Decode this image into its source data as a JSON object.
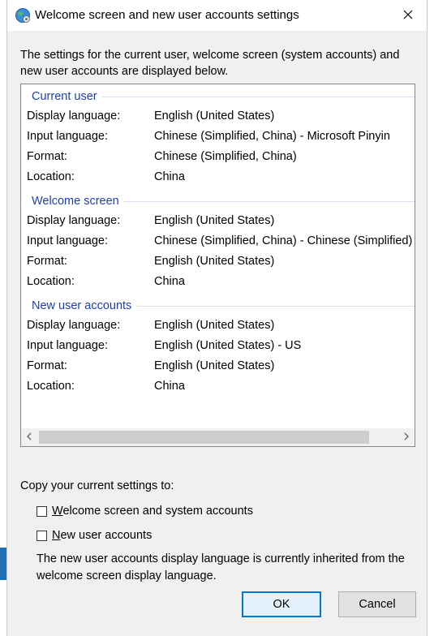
{
  "window": {
    "title": "Welcome screen and new user accounts settings"
  },
  "intro": "The settings for the current user, welcome screen (system accounts) and new user accounts are displayed below.",
  "groups": [
    {
      "header": "Current user",
      "rows": [
        {
          "key": "Display language:",
          "value": "English (United States)"
        },
        {
          "key": "Input language:",
          "value": "Chinese (Simplified, China) - Microsoft Pinyin"
        },
        {
          "key": "Format:",
          "value": "Chinese (Simplified, China)"
        },
        {
          "key": "Location:",
          "value": "China"
        }
      ]
    },
    {
      "header": "Welcome screen",
      "rows": [
        {
          "key": "Display language:",
          "value": "English (United States)"
        },
        {
          "key": "Input language:",
          "value": "Chinese (Simplified, China) - Chinese (Simplified)"
        },
        {
          "key": "Format:",
          "value": "English (United States)"
        },
        {
          "key": "Location:",
          "value": "China"
        }
      ]
    },
    {
      "header": "New user accounts",
      "rows": [
        {
          "key": "Display language:",
          "value": "English (United States)"
        },
        {
          "key": "Input language:",
          "value": "English (United States) - US"
        },
        {
          "key": "Format:",
          "value": "English (United States)"
        },
        {
          "key": "Location:",
          "value": "China"
        }
      ]
    }
  ],
  "copy_section": {
    "label": "Copy your current settings to:",
    "checkboxes": [
      {
        "first_letter": "W",
        "rest": "elcome screen and system accounts",
        "checked": false
      },
      {
        "first_letter": "N",
        "rest": "ew user accounts",
        "checked": false
      }
    ],
    "note": "The new user accounts display language is currently inherited from the welcome screen display language."
  },
  "buttons": {
    "ok": "OK",
    "cancel": "Cancel"
  },
  "icons": {
    "app": "globe-settings-icon",
    "close": "close-icon",
    "scroll_left": "chevron-left-icon",
    "scroll_right": "chevron-right-icon"
  },
  "colors": {
    "group_header": "#1f3fb0",
    "ok_border": "#0078d7"
  }
}
